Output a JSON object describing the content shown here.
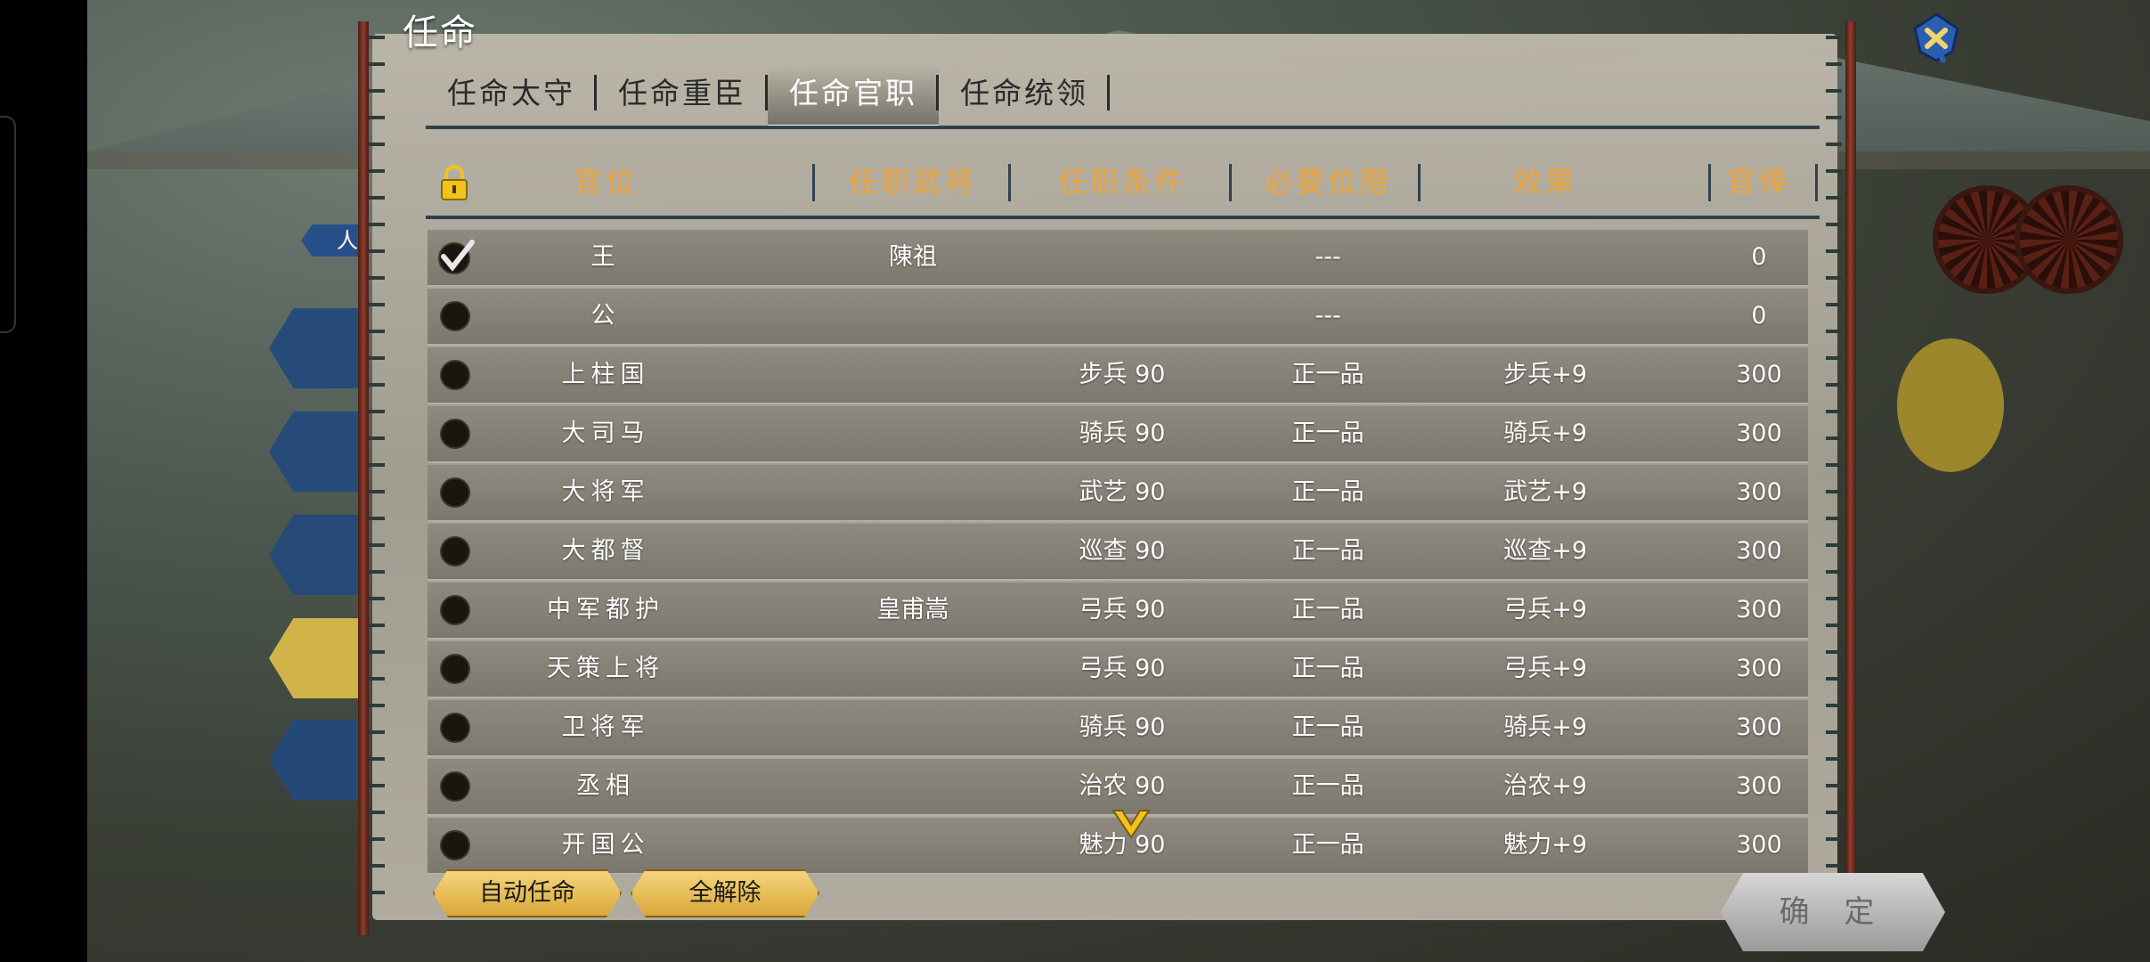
{
  "dialog": {
    "title": "任命"
  },
  "tabs": [
    {
      "label": "任命太守",
      "active": false
    },
    {
      "label": "任命重臣",
      "active": false
    },
    {
      "label": "任命官职",
      "active": true
    },
    {
      "label": "任命统领",
      "active": false
    }
  ],
  "columns": {
    "position": "官位",
    "general": "任职武将",
    "requirement": "任职条件",
    "rank": "必要位階",
    "effect": "效果",
    "salary": "官俸"
  },
  "rows": [
    {
      "checked": true,
      "position": "王",
      "general": "陳祖",
      "requirement": "",
      "rank": "---",
      "effect": "",
      "salary": "0"
    },
    {
      "checked": false,
      "position": "公",
      "general": "",
      "requirement": "",
      "rank": "---",
      "effect": "",
      "salary": "0"
    },
    {
      "checked": false,
      "position": "上柱国",
      "general": "",
      "requirement": "步兵 90",
      "rank": "正一品",
      "effect": "步兵+9",
      "salary": "300"
    },
    {
      "checked": false,
      "position": "大司马",
      "general": "",
      "requirement": "骑兵 90",
      "rank": "正一品",
      "effect": "骑兵+9",
      "salary": "300"
    },
    {
      "checked": false,
      "position": "大将军",
      "general": "",
      "requirement": "武艺 90",
      "rank": "正一品",
      "effect": "武艺+9",
      "salary": "300"
    },
    {
      "checked": false,
      "position": "大都督",
      "general": "",
      "requirement": "巡查 90",
      "rank": "正一品",
      "effect": "巡查+9",
      "salary": "300"
    },
    {
      "checked": false,
      "position": "中军都护",
      "general": "皇甫嵩",
      "requirement": "弓兵 90",
      "rank": "正一品",
      "effect": "弓兵+9",
      "salary": "300"
    },
    {
      "checked": false,
      "position": "天策上将",
      "general": "",
      "requirement": "弓兵 90",
      "rank": "正一品",
      "effect": "弓兵+9",
      "salary": "300"
    },
    {
      "checked": false,
      "position": "卫将军",
      "general": "",
      "requirement": "骑兵 90",
      "rank": "正一品",
      "effect": "骑兵+9",
      "salary": "300"
    },
    {
      "checked": false,
      "position": "丞相",
      "general": "",
      "requirement": "治农 90",
      "rank": "正一品",
      "effect": "治农+9",
      "salary": "300"
    },
    {
      "checked": false,
      "position": "开国公",
      "general": "",
      "requirement": "魅力 90",
      "rank": "正一品",
      "effect": "魅力+9",
      "salary": "300"
    }
  ],
  "buttons": {
    "auto": "自动任命",
    "clear": "全解除",
    "confirm_1": "确",
    "confirm_2": "定"
  },
  "side": {
    "tag": "人"
  },
  "icons": {
    "lock": "lock-icon",
    "close": "close-icon",
    "check": "checkmark-icon",
    "scroll": "chevron-down-icon"
  },
  "colors": {
    "header_text": "#f0a43a",
    "tab_active": "#ffffff",
    "row_text": "#ffffff"
  }
}
